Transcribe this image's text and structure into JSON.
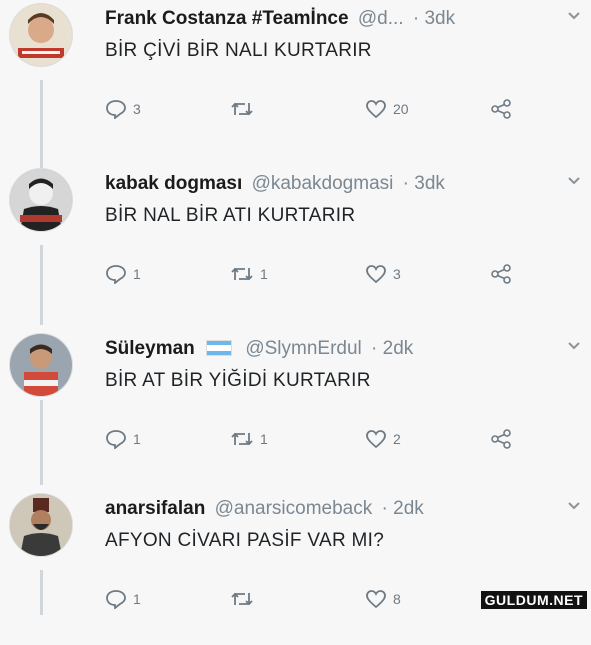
{
  "tweets": [
    {
      "name": "Frank Costanza #Teamİnce",
      "handle": "@d...",
      "time": "· 3dk",
      "text": "BİR ÇİVİ BİR NALI KURTARIR",
      "replies": "3",
      "retweets": "",
      "likes": "20"
    },
    {
      "name": "kabak dogması",
      "handle": "@kabakdogmasi",
      "time": "· 3dk",
      "text": "BİR NAL BİR ATI KURTARIR",
      "replies": "1",
      "retweets": "1",
      "likes": "3"
    },
    {
      "name": "Süleyman",
      "handle": "@SlymnErdul",
      "time": "· 2dk",
      "text": "BİR AT BİR YİĞİDİ KURTARIR",
      "replies": "1",
      "retweets": "1",
      "likes": "2"
    },
    {
      "name": "anarsifalan",
      "handle": "@anarsicomeback",
      "time": "· 2dk",
      "text": "AFYON CİVARI PASİF VAR MI?",
      "replies": "1",
      "retweets": "",
      "likes": "8"
    }
  ],
  "icons": {
    "reply": "reply-icon",
    "retweet": "retweet-icon",
    "like": "heart-icon",
    "share": "share-icon",
    "more": "chevron-down-icon"
  },
  "watermark": "GULDUM.NET"
}
